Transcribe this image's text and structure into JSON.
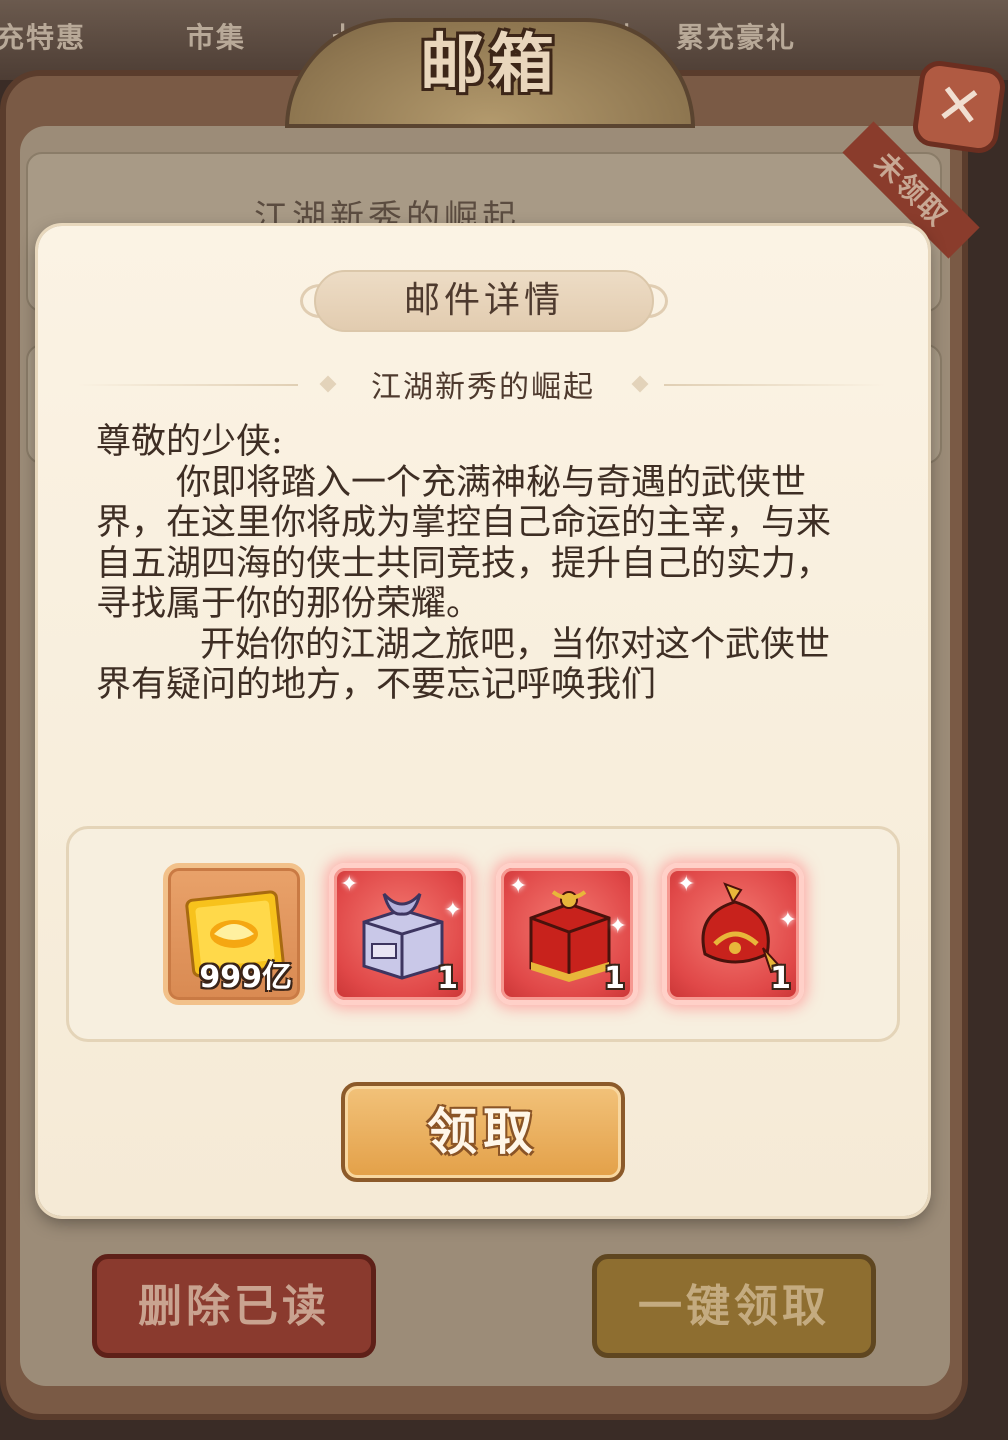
{
  "top_tabs": [
    "充特惠",
    "市集",
    "七",
    "礼",
    "累充豪礼"
  ],
  "window": {
    "title": "邮箱",
    "close_label": "✕"
  },
  "background_mail": {
    "subject": "江湖新秀的崛起",
    "status_ribbon": "未领取"
  },
  "modal": {
    "header": "邮件详情",
    "subject": "江湖新秀的崛起",
    "greeting": "尊敬的少侠:",
    "paragraph1": "你即将踏入一个充满神秘与奇遇的武侠世界，在这里你将成为掌控自己命运的主宰，与来自五湖四海的侠士共同竞技，提升自己的实力，寻找属于你的那份荣耀。",
    "paragraph2": "开始你的江湖之旅吧，当你对这个武侠世界有疑问的地方，不要忘记呼唤我们",
    "attachments": [
      {
        "icon": "gold-ingot-card-icon",
        "count": "999亿"
      },
      {
        "icon": "wrapped-chest-icon",
        "count": "1"
      },
      {
        "icon": "red-gift-box-icon",
        "count": "1"
      },
      {
        "icon": "red-helmet-icon",
        "count": "1"
      }
    ],
    "claim_label": "领取"
  },
  "footer": {
    "delete_read_label": "删除已读",
    "claim_all_label": "一键领取"
  },
  "colors": {
    "accent_gold": "#e3a048",
    "accent_red": "#e04848",
    "panel_bg": "#fbf3e4"
  }
}
